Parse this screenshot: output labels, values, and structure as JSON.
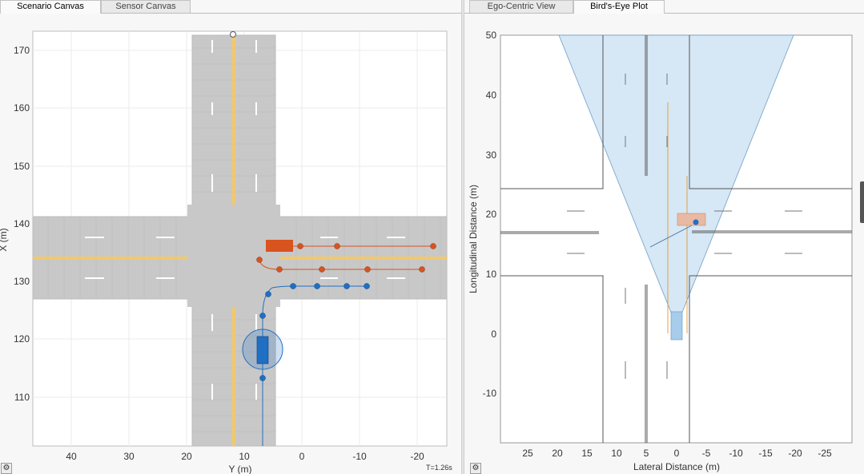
{
  "left_tabs": [
    {
      "label": "Scenario Canvas",
      "active": true
    },
    {
      "label": "Sensor Canvas",
      "active": false
    }
  ],
  "right_tabs": [
    {
      "label": "Ego-Centric View",
      "active": false
    },
    {
      "label": "Bird's-Eye Plot",
      "active": true
    }
  ],
  "scenario": {
    "x_axis_label": "Y (m)",
    "y_axis_label": "X (m)",
    "x_ticks": [
      "40",
      "30",
      "20",
      "10",
      "0",
      "-10",
      "-20"
    ],
    "y_ticks": [
      "170",
      "160",
      "150",
      "140",
      "130",
      "120",
      "110"
    ],
    "time_label": "T=1.26s"
  },
  "birds_eye": {
    "x_axis_label": "Lateral Distance (m)",
    "y_axis_label": "Longitudinal Distance (m)",
    "x_ticks": [
      "25",
      "20",
      "15",
      "10",
      "5",
      "0",
      "-5",
      "-10",
      "-15",
      "-20",
      "-25"
    ],
    "y_ticks": [
      "50",
      "40",
      "30",
      "20",
      "10",
      "0",
      "-10"
    ]
  },
  "colors": {
    "road": "#c8c8c8",
    "lane_yellow": "#f2c86b",
    "ego_blue": "#1f6fc4",
    "target_orange": "#d9531e",
    "coverage_blue": "#cfe3f3"
  },
  "icons": {
    "settings_left": "gear-icon",
    "settings_right": "gear-icon"
  }
}
